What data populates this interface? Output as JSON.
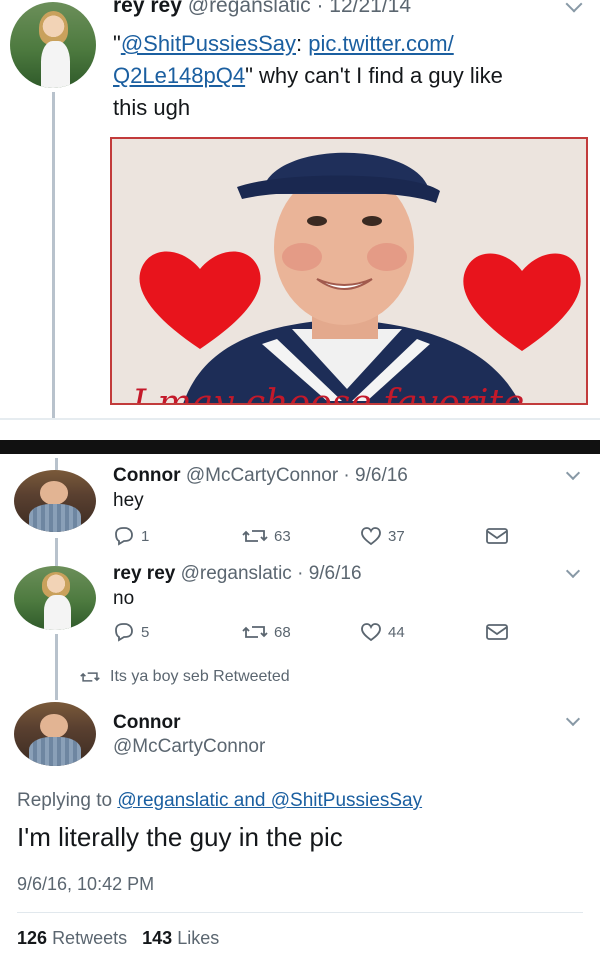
{
  "top_tweet": {
    "name": "rey rey",
    "handle": "@reganslatic",
    "date": "12/21/14",
    "text_open": "\"",
    "mention": "@ShitPussiesSay",
    "colon": ":",
    "link1": "pic.twitter.com/",
    "link2": "Q2Le148pQ4",
    "text_rest": "\" why can't I find a guy like",
    "text_last": "this ugh"
  },
  "reply1": {
    "name": "Connor",
    "handle": "@McCartyConnor",
    "date": "9/6/16",
    "text": "hey",
    "replies": "1",
    "retweets": "63",
    "likes": "37"
  },
  "reply2": {
    "name": "rey rey",
    "handle": "@reganslatic",
    "date": "9/6/16",
    "text": "no",
    "replies": "5",
    "retweets": "68",
    "likes": "44"
  },
  "retweet_note": "Its ya boy seb Retweeted",
  "main_tweet": {
    "name": "Connor",
    "handle": "@McCartyConnor",
    "replying_prefix": "Replying to",
    "replying_to": "@reganslatic and @ShitPussiesSay",
    "text": "I'm literally the guy in the pic",
    "timestamp": "9/6/16, 10:42 PM",
    "retweet_count": "126",
    "retweet_label": "Retweets",
    "like_count": "143",
    "like_label": "Likes"
  },
  "colors": {
    "text": "#14171a",
    "secondary": "#5b6670",
    "link": "#1b5fa0",
    "heart": "#e8141c",
    "cap": "#1f2f5a"
  }
}
